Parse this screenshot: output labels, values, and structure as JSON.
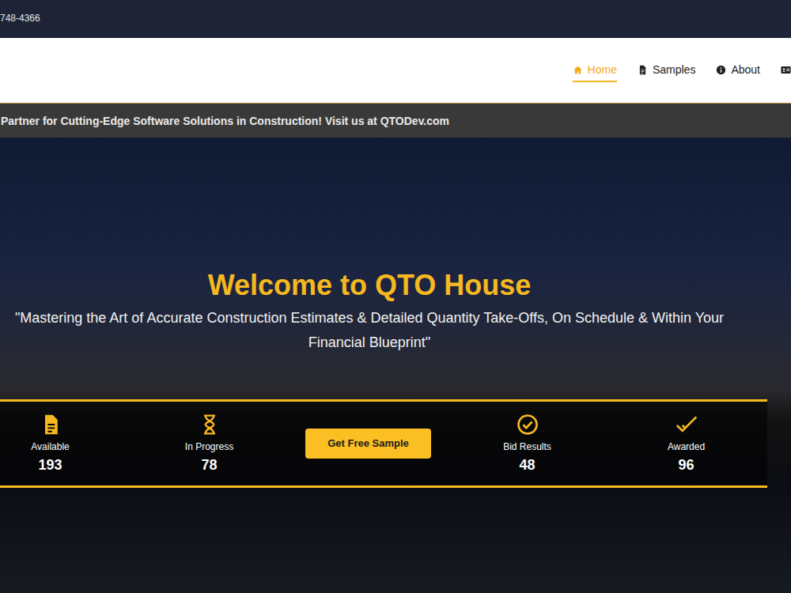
{
  "top_bar": {
    "phone": "748-4366"
  },
  "nav": {
    "items": [
      {
        "label": "Home",
        "selected": true
      },
      {
        "label": "Samples",
        "selected": false
      },
      {
        "label": "About",
        "selected": false
      }
    ]
  },
  "announcement": "Partner for Cutting-Edge Software Solutions in Construction! Visit us at QTODev.com",
  "hero": {
    "title": "Welcome to QTO House",
    "subtitle": "\"Mastering the Art of Accurate Construction Estimates & Detailed Quantity Take-Offs, On Schedule & Within Your Financial Blueprint\""
  },
  "stats": [
    {
      "label": "Available",
      "value": "193"
    },
    {
      "label": "In Progress",
      "value": "78"
    },
    {
      "label": "Bid Results",
      "value": "48"
    },
    {
      "label": "Awarded",
      "value": "96"
    }
  ],
  "cta": {
    "label": "Get Free Sample"
  }
}
